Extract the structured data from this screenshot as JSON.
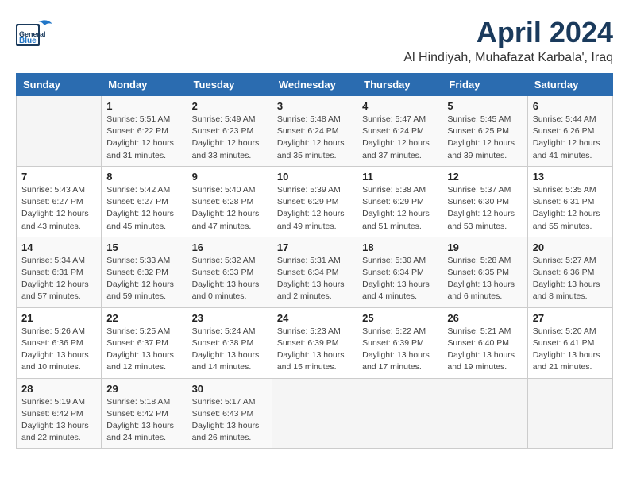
{
  "header": {
    "logo_line1": "General",
    "logo_line2": "Blue",
    "month_title": "April 2024",
    "subtitle": "Al Hindiyah, Muhafazat Karbala', Iraq"
  },
  "weekdays": [
    "Sunday",
    "Monday",
    "Tuesday",
    "Wednesday",
    "Thursday",
    "Friday",
    "Saturday"
  ],
  "weeks": [
    [
      {
        "day": "",
        "info": ""
      },
      {
        "day": "1",
        "info": "Sunrise: 5:51 AM\nSunset: 6:22 PM\nDaylight: 12 hours\nand 31 minutes."
      },
      {
        "day": "2",
        "info": "Sunrise: 5:49 AM\nSunset: 6:23 PM\nDaylight: 12 hours\nand 33 minutes."
      },
      {
        "day": "3",
        "info": "Sunrise: 5:48 AM\nSunset: 6:24 PM\nDaylight: 12 hours\nand 35 minutes."
      },
      {
        "day": "4",
        "info": "Sunrise: 5:47 AM\nSunset: 6:24 PM\nDaylight: 12 hours\nand 37 minutes."
      },
      {
        "day": "5",
        "info": "Sunrise: 5:45 AM\nSunset: 6:25 PM\nDaylight: 12 hours\nand 39 minutes."
      },
      {
        "day": "6",
        "info": "Sunrise: 5:44 AM\nSunset: 6:26 PM\nDaylight: 12 hours\nand 41 minutes."
      }
    ],
    [
      {
        "day": "7",
        "info": "Sunrise: 5:43 AM\nSunset: 6:27 PM\nDaylight: 12 hours\nand 43 minutes."
      },
      {
        "day": "8",
        "info": "Sunrise: 5:42 AM\nSunset: 6:27 PM\nDaylight: 12 hours\nand 45 minutes."
      },
      {
        "day": "9",
        "info": "Sunrise: 5:40 AM\nSunset: 6:28 PM\nDaylight: 12 hours\nand 47 minutes."
      },
      {
        "day": "10",
        "info": "Sunrise: 5:39 AM\nSunset: 6:29 PM\nDaylight: 12 hours\nand 49 minutes."
      },
      {
        "day": "11",
        "info": "Sunrise: 5:38 AM\nSunset: 6:29 PM\nDaylight: 12 hours\nand 51 minutes."
      },
      {
        "day": "12",
        "info": "Sunrise: 5:37 AM\nSunset: 6:30 PM\nDaylight: 12 hours\nand 53 minutes."
      },
      {
        "day": "13",
        "info": "Sunrise: 5:35 AM\nSunset: 6:31 PM\nDaylight: 12 hours\nand 55 minutes."
      }
    ],
    [
      {
        "day": "14",
        "info": "Sunrise: 5:34 AM\nSunset: 6:31 PM\nDaylight: 12 hours\nand 57 minutes."
      },
      {
        "day": "15",
        "info": "Sunrise: 5:33 AM\nSunset: 6:32 PM\nDaylight: 12 hours\nand 59 minutes."
      },
      {
        "day": "16",
        "info": "Sunrise: 5:32 AM\nSunset: 6:33 PM\nDaylight: 13 hours\nand 0 minutes."
      },
      {
        "day": "17",
        "info": "Sunrise: 5:31 AM\nSunset: 6:34 PM\nDaylight: 13 hours\nand 2 minutes."
      },
      {
        "day": "18",
        "info": "Sunrise: 5:30 AM\nSunset: 6:34 PM\nDaylight: 13 hours\nand 4 minutes."
      },
      {
        "day": "19",
        "info": "Sunrise: 5:28 AM\nSunset: 6:35 PM\nDaylight: 13 hours\nand 6 minutes."
      },
      {
        "day": "20",
        "info": "Sunrise: 5:27 AM\nSunset: 6:36 PM\nDaylight: 13 hours\nand 8 minutes."
      }
    ],
    [
      {
        "day": "21",
        "info": "Sunrise: 5:26 AM\nSunset: 6:36 PM\nDaylight: 13 hours\nand 10 minutes."
      },
      {
        "day": "22",
        "info": "Sunrise: 5:25 AM\nSunset: 6:37 PM\nDaylight: 13 hours\nand 12 minutes."
      },
      {
        "day": "23",
        "info": "Sunrise: 5:24 AM\nSunset: 6:38 PM\nDaylight: 13 hours\nand 14 minutes."
      },
      {
        "day": "24",
        "info": "Sunrise: 5:23 AM\nSunset: 6:39 PM\nDaylight: 13 hours\nand 15 minutes."
      },
      {
        "day": "25",
        "info": "Sunrise: 5:22 AM\nSunset: 6:39 PM\nDaylight: 13 hours\nand 17 minutes."
      },
      {
        "day": "26",
        "info": "Sunrise: 5:21 AM\nSunset: 6:40 PM\nDaylight: 13 hours\nand 19 minutes."
      },
      {
        "day": "27",
        "info": "Sunrise: 5:20 AM\nSunset: 6:41 PM\nDaylight: 13 hours\nand 21 minutes."
      }
    ],
    [
      {
        "day": "28",
        "info": "Sunrise: 5:19 AM\nSunset: 6:42 PM\nDaylight: 13 hours\nand 22 minutes."
      },
      {
        "day": "29",
        "info": "Sunrise: 5:18 AM\nSunset: 6:42 PM\nDaylight: 13 hours\nand 24 minutes."
      },
      {
        "day": "30",
        "info": "Sunrise: 5:17 AM\nSunset: 6:43 PM\nDaylight: 13 hours\nand 26 minutes."
      },
      {
        "day": "",
        "info": ""
      },
      {
        "day": "",
        "info": ""
      },
      {
        "day": "",
        "info": ""
      },
      {
        "day": "",
        "info": ""
      }
    ]
  ]
}
